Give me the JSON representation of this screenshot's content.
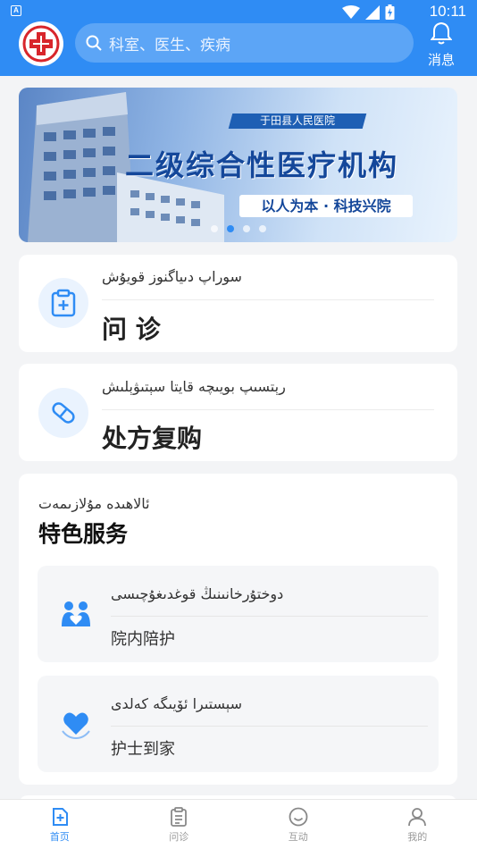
{
  "status_bar": {
    "app_mark": "A",
    "time": "10:11"
  },
  "header": {
    "search_placeholder": "科室、医生、疾病",
    "message_label": "消息"
  },
  "banner": {
    "hospital_name": "于田县人民医院",
    "title": "二级综合性医疗机构",
    "slogan": "以人为本 · 科技兴院",
    "dots": 4,
    "active_dot": 1
  },
  "cards": [
    {
      "uyghur": "سوراپ دىياگنوز قويۇش",
      "chinese": "问 诊",
      "icon": "clipboard-plus-icon"
    },
    {
      "uyghur": "رېتسىپ بويىچە قايتا سېتىۋېلىش",
      "chinese": "处方复购",
      "icon": "pill-icon"
    }
  ],
  "featured": {
    "uyghur": "ئالاھىدە مۇلازىمەت",
    "title": "特色服务",
    "items": [
      {
        "uyghur": "دوختۇرخانىنىڭ قوغدىغۇچىسى",
        "chinese": "院内陪护",
        "icon": "companion-icon"
      },
      {
        "uyghur": "سېستىرا ئۆيىگە كەلدى",
        "chinese": "护士到家",
        "icon": "heart-hand-icon"
      }
    ]
  },
  "tabbar": [
    {
      "label": "首页",
      "icon": "home-plus-icon",
      "active": true
    },
    {
      "label": "问诊",
      "icon": "clipboard-icon",
      "active": false
    },
    {
      "label": "互动",
      "icon": "smile-icon",
      "active": false
    },
    {
      "label": "我的",
      "icon": "user-icon",
      "active": false
    }
  ],
  "colors": {
    "primary": "#2f8cf4",
    "banner_text": "#14479a"
  }
}
